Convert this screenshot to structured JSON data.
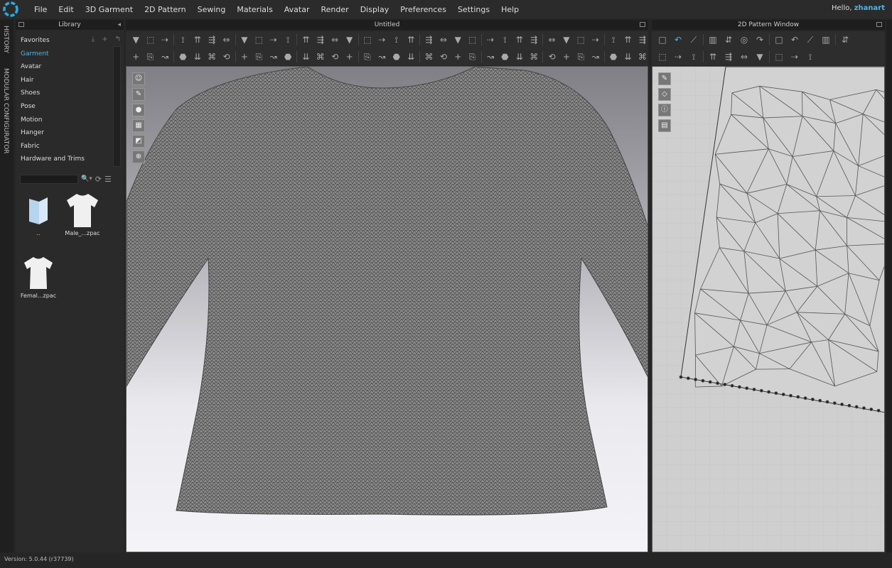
{
  "menu": [
    "File",
    "Edit",
    "3D Garment",
    "2D Pattern",
    "Sewing",
    "Materials",
    "Avatar",
    "Render",
    "Display",
    "Preferences",
    "Settings",
    "Help"
  ],
  "user": {
    "greeting": "Hello,",
    "name": "zhanart"
  },
  "side_tabs": {
    "history": "HISTORY",
    "modular": "MODULAR CONFIGURATOR"
  },
  "library": {
    "title": "Library",
    "categories": [
      "Favorites",
      "Garment",
      "Avatar",
      "Hair",
      "Shoes",
      "Pose",
      "Motion",
      "Hanger",
      "Fabric",
      "Hardware and Trims"
    ],
    "active": "Garment",
    "search_placeholder": "",
    "files": [
      {
        "name": "..",
        "type": "folder"
      },
      {
        "name": "Male_...zpac",
        "type": "shirt"
      },
      {
        "name": "Femal...zpac",
        "type": "shirt"
      }
    ]
  },
  "viewport": {
    "title": "Untitled"
  },
  "pattern_window": {
    "title": "2D Pattern Window"
  },
  "accent": "#4fb5e8",
  "status": {
    "version": "Version: 5.0.44 (r37739)"
  }
}
